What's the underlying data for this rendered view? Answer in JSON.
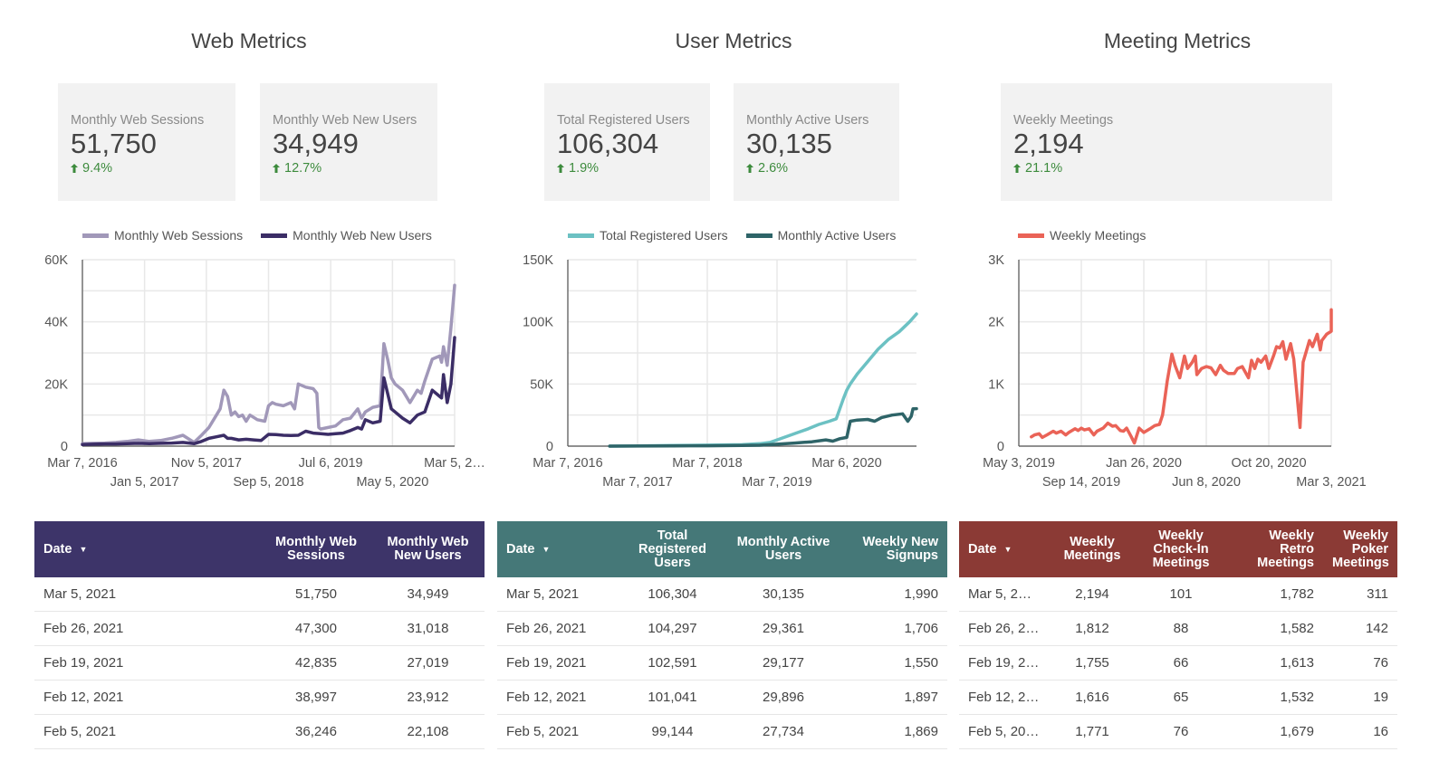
{
  "colors": {
    "web_sessions": "#a198b9",
    "web_new_users": "#3b2d66",
    "web_header": "#3d3469",
    "total_registered": "#6cc1c3",
    "monthly_active": "#2e6468",
    "user_header": "#457878",
    "weekly_meetings": "#ea6357",
    "meeting_header": "#8b3a35",
    "delta_positive": "#3d8b3d"
  },
  "sections": [
    {
      "title": "Web Metrics",
      "scorecards": [
        {
          "label": "Monthly Web Sessions",
          "value": "51,750",
          "delta": "9.4%",
          "direction": "up"
        },
        {
          "label": "Monthly Web New Users",
          "value": "34,949",
          "delta": "12.7%",
          "direction": "up"
        }
      ],
      "table": {
        "headers": [
          "Date",
          "Monthly Web Sessions",
          "Monthly Web New Users"
        ],
        "sort_icon": "▼",
        "rows": [
          [
            "Mar 5, 2021",
            "51,750",
            "34,949"
          ],
          [
            "Feb 26, 2021",
            "47,300",
            "31,018"
          ],
          [
            "Feb 19, 2021",
            "42,835",
            "27,019"
          ],
          [
            "Feb 12, 2021",
            "38,997",
            "23,912"
          ],
          [
            "Feb 5, 2021",
            "36,246",
            "22,108"
          ]
        ]
      }
    },
    {
      "title": "User Metrics",
      "scorecards": [
        {
          "label": "Total Registered Users",
          "value": "106,304",
          "delta": "1.9%",
          "direction": "up"
        },
        {
          "label": "Monthly Active Users",
          "value": "30,135",
          "delta": "2.6%",
          "direction": "up"
        }
      ],
      "table": {
        "headers": [
          "Date",
          "Total Registered Users",
          "Monthly Active Users",
          "Weekly New Signups"
        ],
        "sort_icon": "▼",
        "rows": [
          [
            "Mar 5, 2021",
            "106,304",
            "30,135",
            "1,990"
          ],
          [
            "Feb 26, 2021",
            "104,297",
            "29,361",
            "1,706"
          ],
          [
            "Feb 19, 2021",
            "102,591",
            "29,177",
            "1,550"
          ],
          [
            "Feb 12, 2021",
            "101,041",
            "29,896",
            "1,897"
          ],
          [
            "Feb 5, 2021",
            "99,144",
            "27,734",
            "1,869"
          ]
        ]
      }
    },
    {
      "title": "Meeting Metrics",
      "scorecards": [
        {
          "label": "Weekly Meetings",
          "value": "2,194",
          "delta": "21.1%",
          "direction": "up"
        }
      ],
      "table": {
        "headers": [
          "Date",
          "Weekly Meetings",
          "Weekly Check-In Meetings",
          "Weekly Retro Meetings",
          "Weekly Poker Meetings"
        ],
        "sort_icon": "▼",
        "rows": [
          [
            "Mar 5, 2…",
            "2,194",
            "101",
            "1,782",
            "311"
          ],
          [
            "Feb 26, 2…",
            "1,812",
            "88",
            "1,582",
            "142"
          ],
          [
            "Feb 19, 2…",
            "1,755",
            "66",
            "1,613",
            "76"
          ],
          [
            "Feb 12, 2…",
            "1,616",
            "65",
            "1,532",
            "19"
          ],
          [
            "Feb 5, 20…",
            "1,771",
            "76",
            "1,679",
            "16"
          ]
        ]
      }
    }
  ],
  "chart_data": [
    {
      "type": "line",
      "title": "",
      "legend_position": "top",
      "grid": true,
      "xlabel": "",
      "ylabel": "",
      "x_range": [
        0,
        1
      ],
      "ylim": [
        0,
        60000
      ],
      "y_ticks": [
        0,
        20000,
        40000,
        60000
      ],
      "y_tick_labels": [
        "0",
        "20K",
        "40K",
        "60K"
      ],
      "x_tick_labels": [
        "Mar 7, 2016",
        "Jan 5, 2017",
        "Nov 5, 2017",
        "Sep 5, 2018",
        "Jul 6, 2019",
        "May 5, 2020",
        "Mar 5, 2…"
      ],
      "x_tick_positions": [
        0,
        0.167,
        0.333,
        0.5,
        0.667,
        0.833,
        1.0
      ],
      "series": [
        {
          "name": "Monthly Web Sessions",
          "x": [
            0,
            0.03,
            0.06,
            0.09,
            0.12,
            0.15,
            0.18,
            0.21,
            0.24,
            0.27,
            0.3,
            0.32,
            0.34,
            0.36,
            0.37,
            0.38,
            0.39,
            0.4,
            0.41,
            0.42,
            0.43,
            0.44,
            0.45,
            0.47,
            0.49,
            0.5,
            0.51,
            0.52,
            0.54,
            0.56,
            0.57,
            0.58,
            0.6,
            0.62,
            0.63,
            0.635,
            0.64,
            0.66,
            0.68,
            0.7,
            0.72,
            0.74,
            0.75,
            0.76,
            0.78,
            0.8,
            0.81,
            0.82,
            0.83,
            0.84,
            0.86,
            0.88,
            0.9,
            0.91,
            0.92,
            0.94,
            0.96,
            0.965,
            0.97,
            0.98,
            0.99,
            1.0
          ],
          "values": [
            800,
            900,
            1000,
            1200,
            1500,
            2000,
            1500,
            1800,
            2500,
            3500,
            1200,
            3500,
            6000,
            10000,
            12000,
            18000,
            16000,
            10000,
            11000,
            9500,
            10000,
            8000,
            10000,
            8500,
            8000,
            13000,
            14000,
            13500,
            13000,
            14000,
            12000,
            20000,
            19000,
            18500,
            17000,
            6000,
            5500,
            6000,
            6500,
            8500,
            9000,
            12000,
            9000,
            11000,
            12500,
            13000,
            33000,
            28000,
            22000,
            20000,
            18000,
            14000,
            18000,
            17000,
            21000,
            28000,
            29000,
            27000,
            32000,
            26000,
            38000,
            51750
          ]
        },
        {
          "name": "Monthly Web New Users",
          "x": [
            0,
            0.03,
            0.06,
            0.09,
            0.12,
            0.15,
            0.18,
            0.21,
            0.24,
            0.27,
            0.3,
            0.32,
            0.34,
            0.36,
            0.38,
            0.39,
            0.4,
            0.42,
            0.44,
            0.46,
            0.48,
            0.5,
            0.52,
            0.54,
            0.56,
            0.58,
            0.6,
            0.62,
            0.64,
            0.66,
            0.68,
            0.7,
            0.72,
            0.74,
            0.75,
            0.76,
            0.78,
            0.8,
            0.81,
            0.82,
            0.83,
            0.84,
            0.86,
            0.88,
            0.9,
            0.92,
            0.94,
            0.96,
            0.965,
            0.97,
            0.98,
            0.99,
            1.0
          ],
          "values": [
            500,
            600,
            700,
            700,
            800,
            900,
            800,
            900,
            1000,
            1200,
            800,
            1500,
            2500,
            3000,
            3500,
            2500,
            2500,
            2000,
            2200,
            2000,
            1800,
            3800,
            3700,
            3500,
            3400,
            3500,
            4800,
            4200,
            4000,
            3800,
            4000,
            4200,
            5000,
            6000,
            5500,
            8500,
            7500,
            8000,
            22000,
            17000,
            12000,
            11000,
            9000,
            7500,
            10000,
            11000,
            18000,
            16000,
            15500,
            23000,
            14000,
            20000,
            34949
          ]
        }
      ]
    },
    {
      "type": "line",
      "title": "",
      "legend_position": "top",
      "grid": true,
      "xlabel": "",
      "ylabel": "",
      "x_range": [
        0,
        1
      ],
      "ylim": [
        0,
        150000
      ],
      "y_ticks": [
        0,
        50000,
        100000,
        150000
      ],
      "y_tick_labels": [
        "0",
        "50K",
        "100K",
        "150K"
      ],
      "x_tick_labels": [
        "Mar 7, 2016",
        "Mar 7, 2017",
        "Mar 7, 2018",
        "Mar 7, 2019",
        "Mar 6, 2020"
      ],
      "x_tick_positions": [
        0,
        0.2,
        0.4,
        0.6,
        0.8
      ],
      "series": [
        {
          "name": "Total Registered Users",
          "x": [
            0.12,
            0.2,
            0.3,
            0.4,
            0.5,
            0.55,
            0.58,
            0.6,
            0.63,
            0.66,
            0.69,
            0.72,
            0.75,
            0.77,
            0.79,
            0.8,
            0.81,
            0.83,
            0.86,
            0.89,
            0.92,
            0.95,
            0.98,
            1.0
          ],
          "values": [
            0,
            200,
            500,
            800,
            1200,
            2000,
            3000,
            5000,
            8000,
            11000,
            14000,
            17500,
            20000,
            22000,
            38000,
            45000,
            50000,
            58000,
            68000,
            78000,
            86000,
            92000,
            100000,
            106304
          ]
        },
        {
          "name": "Monthly Active Users",
          "x": [
            0.12,
            0.2,
            0.3,
            0.4,
            0.5,
            0.55,
            0.6,
            0.65,
            0.7,
            0.74,
            0.76,
            0.78,
            0.8,
            0.81,
            0.83,
            0.86,
            0.88,
            0.9,
            0.93,
            0.96,
            0.975,
            0.985,
            0.99,
            1.0
          ],
          "values": [
            0,
            100,
            200,
            300,
            500,
            700,
            1500,
            2500,
            3500,
            5000,
            4000,
            6000,
            7000,
            20000,
            21000,
            21500,
            20000,
            23000,
            25000,
            26000,
            20000,
            24000,
            30000,
            30135
          ]
        }
      ]
    },
    {
      "type": "line",
      "title": "",
      "legend_position": "top",
      "grid": true,
      "xlabel": "",
      "ylabel": "",
      "x_range": [
        0,
        1
      ],
      "ylim": [
        0,
        3000
      ],
      "y_ticks": [
        0,
        1000,
        2000,
        3000
      ],
      "y_tick_labels": [
        "0",
        "1K",
        "2K",
        "3K"
      ],
      "x_tick_labels": [
        "May 3, 2019",
        "Sep 14, 2019",
        "Jan 26, 2020",
        "Jun 8, 2020",
        "Oct 20, 2020",
        "Mar 3, 2021"
      ],
      "x_tick_positions": [
        0,
        0.2,
        0.4,
        0.6,
        0.8,
        1.0
      ],
      "series": [
        {
          "name": "Weekly Meetings",
          "x": [
            0.04,
            0.05,
            0.065,
            0.075,
            0.09,
            0.11,
            0.12,
            0.135,
            0.15,
            0.16,
            0.18,
            0.19,
            0.2,
            0.21,
            0.225,
            0.24,
            0.25,
            0.27,
            0.285,
            0.3,
            0.31,
            0.325,
            0.335,
            0.345,
            0.36,
            0.37,
            0.385,
            0.4,
            0.42,
            0.435,
            0.45,
            0.46,
            0.475,
            0.49,
            0.5,
            0.515,
            0.53,
            0.54,
            0.555,
            0.565,
            0.57,
            0.585,
            0.6,
            0.615,
            0.63,
            0.645,
            0.655,
            0.67,
            0.69,
            0.7,
            0.715,
            0.735,
            0.745,
            0.755,
            0.765,
            0.775,
            0.79,
            0.8,
            0.815,
            0.825,
            0.835,
            0.845,
            0.855,
            0.87,
            0.88,
            0.9,
            0.91,
            0.93,
            0.94,
            0.955,
            0.965,
            0.97,
            0.985,
            1.0,
            1.0
          ],
          "values": [
            150,
            180,
            200,
            140,
            180,
            240,
            210,
            240,
            180,
            220,
            280,
            250,
            290,
            260,
            280,
            180,
            240,
            290,
            370,
            320,
            330,
            250,
            240,
            290,
            150,
            50,
            290,
            220,
            280,
            330,
            350,
            500,
            1050,
            1480,
            1300,
            1100,
            1450,
            1250,
            1350,
            1450,
            1150,
            1250,
            1280,
            1260,
            1150,
            1300,
            1220,
            1170,
            1170,
            1250,
            1280,
            1100,
            1380,
            1250,
            1400,
            1350,
            1450,
            1250,
            1450,
            1600,
            1580,
            1680,
            1400,
            1650,
            1400,
            300,
            1350,
            1700,
            1600,
            1800,
            1550,
            1700,
            1800,
            1850,
            2194
          ]
        }
      ]
    }
  ]
}
